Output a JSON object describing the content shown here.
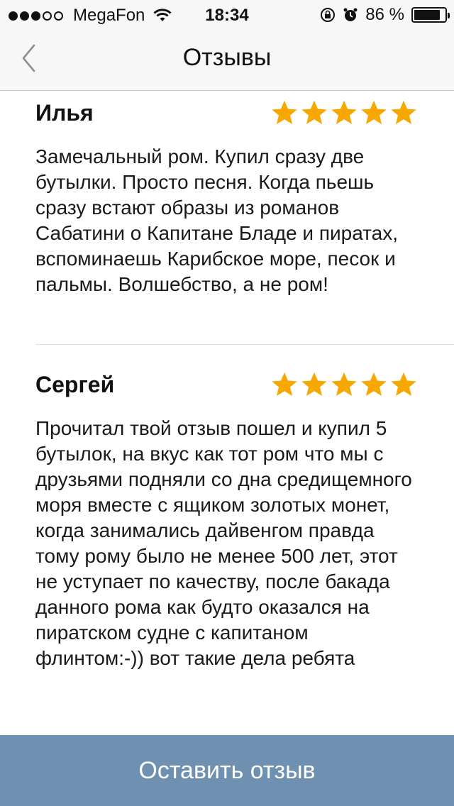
{
  "status_bar": {
    "carrier": "MegaFon",
    "time": "18:34",
    "battery_text": "86 %",
    "battery_level": 0.86,
    "signal_bars_filled": 3,
    "signal_bars_total": 5
  },
  "nav": {
    "title": "Отзывы",
    "back_icon": "chevron-left-icon"
  },
  "reviews": [
    {
      "name": "Илья",
      "rating": 5,
      "text": "Замечальный ром. Купил сразу две бутылки. Просто песня. Когда пьешь сразу встают образы из романов Сабатини о Капитане Бладе и пиратах, вспоминаешь Карибское море, песок и пальмы. Волшебство, а не ром!"
    },
    {
      "name": "Сергей",
      "rating": 5,
      "text": "Прочитал твой отзыв пошел и купил 5 бутылок, на вкус как тот ром что мы с друзьями подняли со дна средищемного моря вместе с ящиком золотых монет, когда занимались дайвенгом правда тому рому было не менее 500 лет, этот не уступает по качеству, после бакада данного рома как будто оказался на пиратском судне с капитаном флинтом:-)) вот такие дела ребята"
    }
  ],
  "bottom_button": {
    "label": "Оставить отзыв"
  },
  "colors": {
    "star": "#f7a800",
    "button_bg": "#6e90b1",
    "nav_bg": "#f7f7f7"
  }
}
